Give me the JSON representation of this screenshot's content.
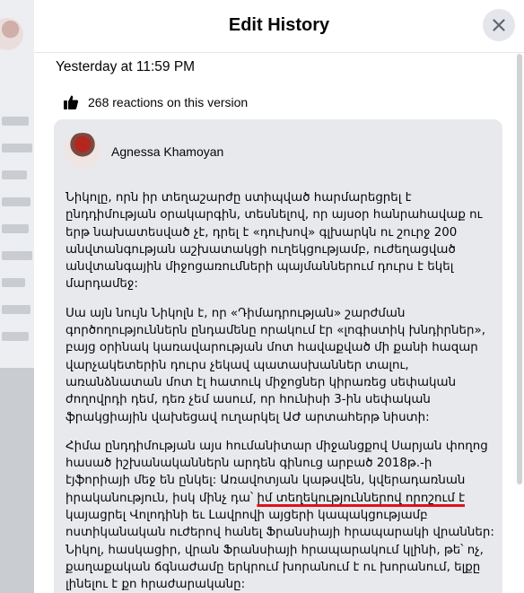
{
  "modal": {
    "title": "Edit History",
    "close_icon": "close-icon"
  },
  "version": {
    "timestamp": "Yesterday at 11:59 PM",
    "reactions_icon": "thumbs-up-icon",
    "reactions_text": "268 reactions on this version"
  },
  "post": {
    "author": "Agnessa Khamoyan",
    "paragraphs": [
      "Նիկոլը, որն իր տեղաշարժը ստիպված հարմարեցրել է ընդդիմության օրակարգին, տեսնելով, որ այսօր հանրահավաք ու երթ նախատեսված չէ, դրել է «դուխով» գլխարկն ու շուրջ 200 անվտանգության աշխատակցի ուղեկցությամբ, ուժեղացված անվտանգային միջոցառումների պայմաններում դուրս է եկել մարդամեջ:",
      "Սա այն նույն Նիկոլն է, որ «Դիմադրության» շարժման գործողություններն ընդամենը որակում էր «լոգիստիկ խնդիրներ», բայց օրինակ կառավարության մոտ հավաքված մի քանի հազար վարչակետերին դուրս չեկավ պատասխաններ տալու, առանձնատան մոտ էլ հատուկ միջոցներ կիրառեց սեփական ժողովրդի դեմ, դեռ չեմ ասում, որ հունիսի 3-ին սեփական ֆրակցիային վախեցավ ուղարկել ԱԺ արտահերթ նիստի:"
    ],
    "p3_before": "Հիմա ընդդիմության այս հումանիտար միջանցքով Սարյան փողոց հասած իշխանականներն արդեն գինուց արբած 2018թ.-ի էյֆորիայի մեջ են ընկել: Առավոտյան կաթսվեն, կվերադառնան իրականություն, իսկ մինչ դա՝ ",
    "p3_underlined": "իմ տեղեկություններով որոշում է",
    "p3_after": " կայացրել Վոլոդինի եւ Լավրովի այցերի կապակցությամբ ոստիկանական ուժերով հանել Ֆրանսիայի հրապարակի վրաններ: Նիկոլ, հասկացիր, վրան Ֆրանսիայի հրապարակում կլինի, թե՝ ոչ, քաղաքական ճգնաժամը երկրում խորանում է ու խորանում, ելքը լինելու է քո հրաժարականը:"
  },
  "colors": {
    "underline": "#e0121b",
    "card_bg": "#e8e9ec"
  }
}
